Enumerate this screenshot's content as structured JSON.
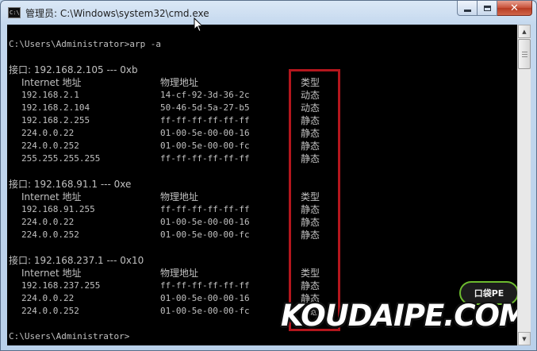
{
  "window": {
    "title": "管理员: C:\\Windows\\system32\\cmd.exe",
    "icon_label": "C:\\"
  },
  "caption_buttons": {
    "close_glyph": "✕"
  },
  "console": {
    "prompt1": "C:\\Users\\Administrator>arp -a",
    "column_headers": {
      "internet": "Internet 地址",
      "physical": "物理地址",
      "type": "类型"
    },
    "interfaces": [
      {
        "header": "接口: 192.168.2.105 --- 0xb",
        "rows": [
          {
            "ip": "192.168.2.1",
            "mac": "14-cf-92-3d-36-2c",
            "type": "动态"
          },
          {
            "ip": "192.168.2.104",
            "mac": "50-46-5d-5a-27-b5",
            "type": "动态"
          },
          {
            "ip": "192.168.2.255",
            "mac": "ff-ff-ff-ff-ff-ff",
            "type": "静态"
          },
          {
            "ip": "224.0.0.22",
            "mac": "01-00-5e-00-00-16",
            "type": "静态"
          },
          {
            "ip": "224.0.0.252",
            "mac": "01-00-5e-00-00-fc",
            "type": "静态"
          },
          {
            "ip": "255.255.255.255",
            "mac": "ff-ff-ff-ff-ff-ff",
            "type": "静态"
          }
        ]
      },
      {
        "header": "接口: 192.168.91.1 --- 0xe",
        "rows": [
          {
            "ip": "192.168.91.255",
            "mac": "ff-ff-ff-ff-ff-ff",
            "type": "静态"
          },
          {
            "ip": "224.0.0.22",
            "mac": "01-00-5e-00-00-16",
            "type": "静态"
          },
          {
            "ip": "224.0.0.252",
            "mac": "01-00-5e-00-00-fc",
            "type": "静态"
          }
        ]
      },
      {
        "header": "接口: 192.168.237.1 --- 0x10",
        "rows": [
          {
            "ip": "192.168.237.255",
            "mac": "ff-ff-ff-ff-ff-ff",
            "type": "静态"
          },
          {
            "ip": "224.0.0.22",
            "mac": "01-00-5e-00-00-16",
            "type": "静态"
          },
          {
            "ip": "224.0.0.252",
            "mac": "01-00-5e-00-00-fc",
            "type": "静态"
          }
        ]
      }
    ],
    "prompt2": "C:\\Users\\Administrator>"
  },
  "watermark": {
    "badge": "口袋PE",
    "text": "KOUDAIPE.COM"
  },
  "colors": {
    "console_bg": "#000000",
    "console_fg": "#c0c0c0",
    "highlight": "#b3161d",
    "badge_ring": "#6dbb2f"
  }
}
